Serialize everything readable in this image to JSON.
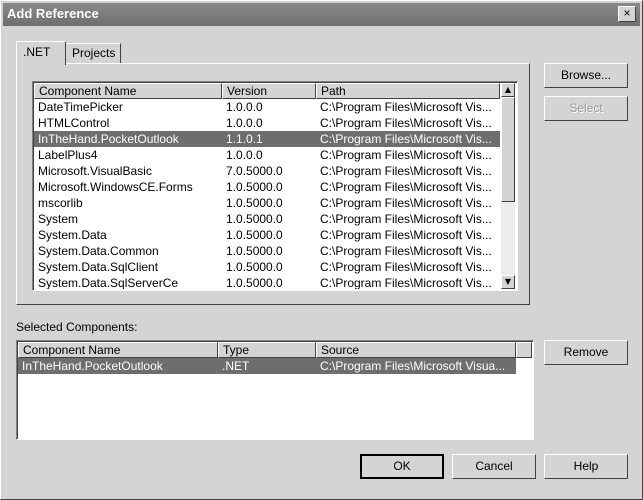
{
  "window": {
    "title": "Add Reference",
    "close_label": "×"
  },
  "tabs": [
    {
      "label": ".NET",
      "active": true
    },
    {
      "label": "Projects",
      "active": false
    }
  ],
  "components_list": {
    "columns": [
      "Component Name",
      "Version",
      "Path"
    ],
    "rows": [
      [
        "DateTimePicker",
        "1.0.0.0",
        "C:\\Program Files\\Microsoft Vis..."
      ],
      [
        "HTMLControl",
        "1.0.0.0",
        "C:\\Program Files\\Microsoft Vis..."
      ],
      [
        "InTheHand.PocketOutlook",
        "1.1.0.1",
        "C:\\Program Files\\Microsoft Vis..."
      ],
      [
        "LabelPlus4",
        "1.0.0.0",
        "C:\\Program Files\\Microsoft Vis..."
      ],
      [
        "Microsoft.VisualBasic",
        "7.0.5000.0",
        "C:\\Program Files\\Microsoft Vis..."
      ],
      [
        "Microsoft.WindowsCE.Forms",
        "1.0.5000.0",
        "C:\\Program Files\\Microsoft Vis..."
      ],
      [
        "mscorlib",
        "1.0.5000.0",
        "C:\\Program Files\\Microsoft Vis..."
      ],
      [
        "System",
        "1.0.5000.0",
        "C:\\Program Files\\Microsoft Vis..."
      ],
      [
        "System.Data",
        "1.0.5000.0",
        "C:\\Program Files\\Microsoft Vis..."
      ],
      [
        "System.Data.Common",
        "1.0.5000.0",
        "C:\\Program Files\\Microsoft Vis..."
      ],
      [
        "System.Data.SqlClient",
        "1.0.5000.0",
        "C:\\Program Files\\Microsoft Vis..."
      ],
      [
        "System.Data.SqlServerCe",
        "1.0.5000.0",
        "C:\\Program Files\\Microsoft Vis..."
      ]
    ],
    "selected_index": 2
  },
  "buttons": {
    "browse": "Browse...",
    "select": "Select",
    "remove": "Remove",
    "ok": "OK",
    "cancel": "Cancel",
    "help": "Help"
  },
  "selected_components": {
    "label": "Selected Components:",
    "columns": [
      "Component Name",
      "Type",
      "Source"
    ],
    "rows": [
      [
        "InTheHand.PocketOutlook",
        ".NET",
        "C:\\Program Files\\Microsoft Visua..."
      ]
    ]
  }
}
